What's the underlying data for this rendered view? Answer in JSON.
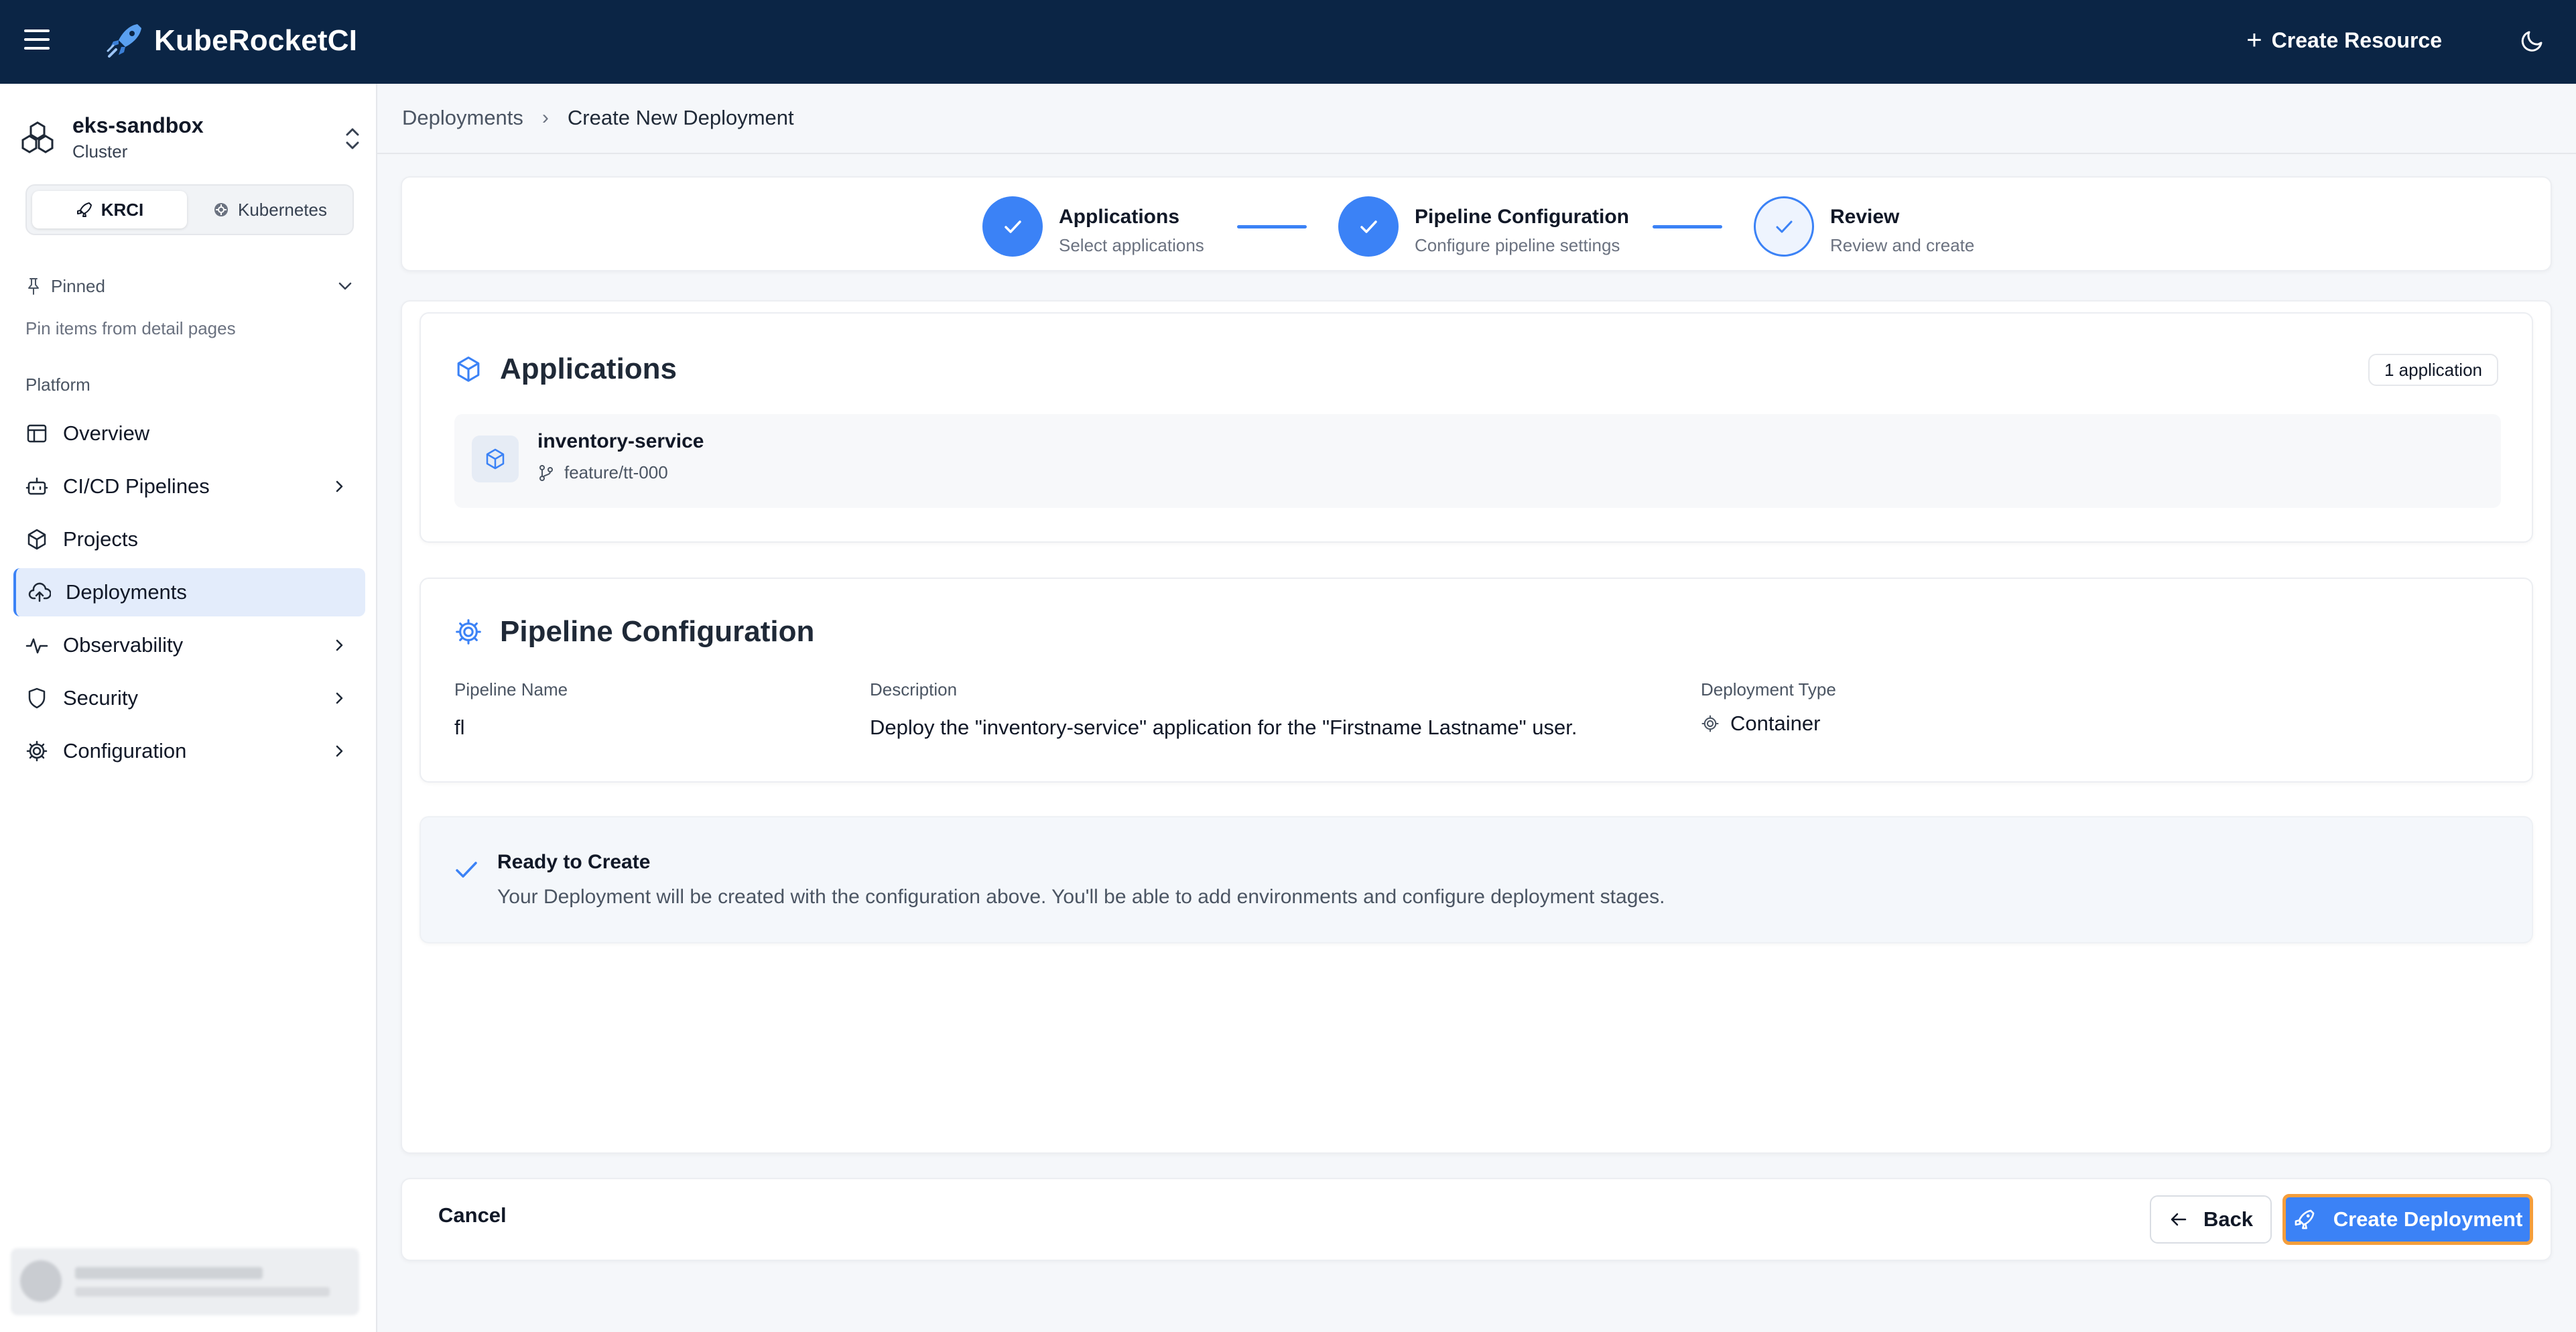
{
  "header": {
    "brand": "KubeRocketCI",
    "create_resource_label": "Create Resource",
    "bg_color": "#0b2545"
  },
  "sidebar": {
    "cluster_name": "eks-sandbox",
    "cluster_type": "Cluster",
    "segments": [
      {
        "label": "KRCI",
        "active": true,
        "icon": "rocket-icon"
      },
      {
        "label": "Kubernetes",
        "active": false,
        "icon": "kubernetes-icon"
      }
    ],
    "pinned_label": "Pinned",
    "pinned_hint": "Pin items from detail pages",
    "section_label": "Platform",
    "items": [
      {
        "label": "Overview",
        "icon": "layout-icon",
        "has_children": false,
        "active": false
      },
      {
        "label": "CI/CD Pipelines",
        "icon": "bot-icon",
        "has_children": true,
        "active": false
      },
      {
        "label": "Projects",
        "icon": "box-icon",
        "has_children": false,
        "active": false
      },
      {
        "label": "Deployments",
        "icon": "cloud-upload-icon",
        "has_children": false,
        "active": true
      },
      {
        "label": "Observability",
        "icon": "activity-icon",
        "has_children": true,
        "active": false
      },
      {
        "label": "Security",
        "icon": "shield-icon",
        "has_children": true,
        "active": false
      },
      {
        "label": "Configuration",
        "icon": "gear-icon",
        "has_children": true,
        "active": false
      }
    ]
  },
  "breadcrumb": {
    "parent": "Deployments",
    "current": "Create New Deployment"
  },
  "stepper": {
    "steps": [
      {
        "title": "Applications",
        "subtitle": "Select applications",
        "state": "done"
      },
      {
        "title": "Pipeline Configuration",
        "subtitle": "Configure pipeline settings",
        "state": "done"
      },
      {
        "title": "Review",
        "subtitle": "Review and create",
        "state": "current"
      }
    ]
  },
  "applications": {
    "title": "Applications",
    "count_badge": "1 application",
    "items": [
      {
        "name": "inventory-service",
        "branch": "feature/tt-000"
      }
    ]
  },
  "pipeline": {
    "title": "Pipeline Configuration",
    "name_label": "Pipeline Name",
    "name_value": "fl",
    "description_label": "Description",
    "description_value": "Deploy the \"inventory-service\" application for the \"Firstname Lastname\" user.",
    "type_label": "Deployment Type",
    "type_value": "Container"
  },
  "ready": {
    "title": "Ready to Create",
    "text": "Your Deployment will be created with the configuration above. You'll be able to add environments and configure deployment stages."
  },
  "footer": {
    "cancel_label": "Cancel",
    "back_label": "Back",
    "create_label": "Create Deployment"
  },
  "colors": {
    "accent": "#3b82f6",
    "highlight_border": "#f59e3b"
  }
}
